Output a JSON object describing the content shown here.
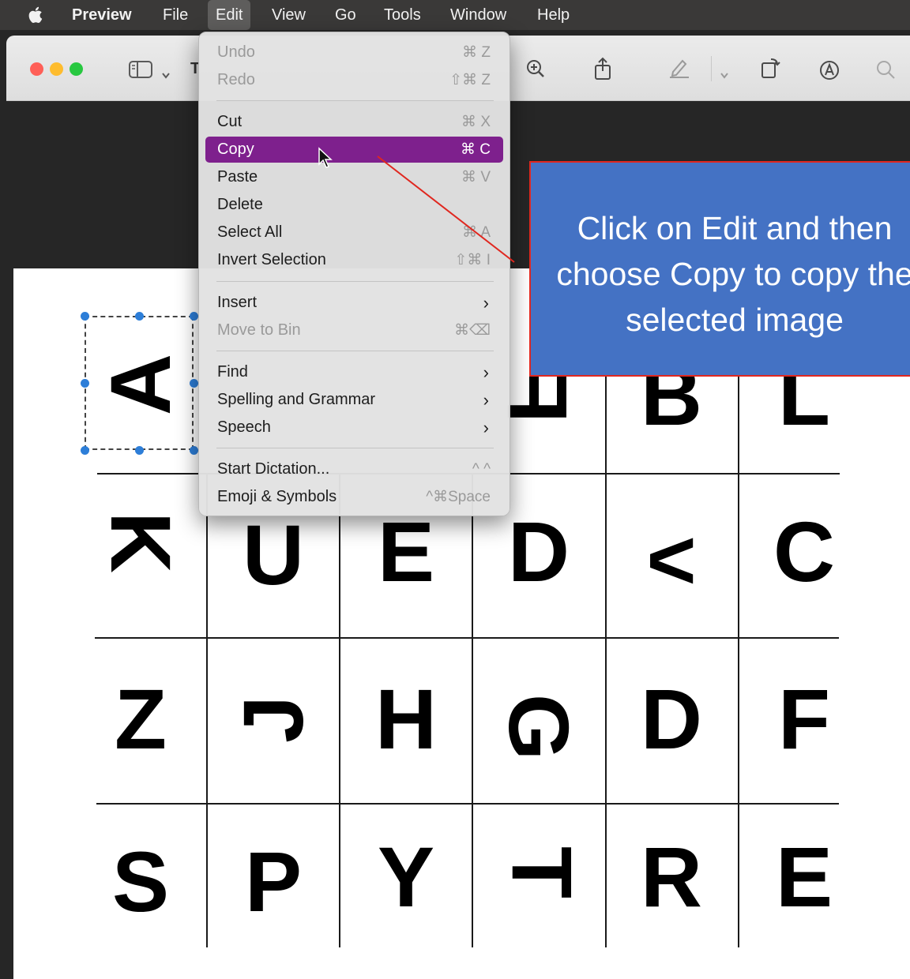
{
  "menubar": {
    "apple_icon": "apple-icon",
    "items": [
      "Preview",
      "File",
      "Edit",
      "View",
      "Go",
      "Tools",
      "Window",
      "Help"
    ],
    "active": "Edit"
  },
  "toolbar": {
    "icons": [
      "sidebar-icon",
      "chevron-down-icon",
      "zoom-in-icon",
      "share-icon",
      "highlight-icon",
      "chevron-down-icon",
      "rotate-icon",
      "markup-icon",
      "search-icon"
    ],
    "title_fragment": "T"
  },
  "edit_menu": {
    "items": [
      {
        "label": "Undo",
        "shortcut": "⌘ Z",
        "enabled": false
      },
      {
        "label": "Redo",
        "shortcut": "⇧⌘ Z",
        "enabled": false
      },
      {
        "label": "Cut",
        "shortcut": "⌘ X",
        "enabled": true
      },
      {
        "label": "Copy",
        "shortcut": "⌘ C",
        "enabled": true,
        "highlighted": true
      },
      {
        "label": "Paste",
        "shortcut": "⌘ V",
        "enabled": true
      },
      {
        "label": "Delete",
        "shortcut": "",
        "enabled": true
      },
      {
        "label": "Select All",
        "shortcut": "⌘ A",
        "enabled": true
      },
      {
        "label": "Invert Selection",
        "shortcut": "⇧⌘ I",
        "enabled": true
      },
      {
        "label": "Insert",
        "submenu": true,
        "enabled": true
      },
      {
        "label": "Move to Bin",
        "shortcut": "⌘⌫",
        "enabled": false
      },
      {
        "label": "Find",
        "submenu": true,
        "enabled": true
      },
      {
        "label": "Spelling and Grammar",
        "submenu": true,
        "enabled": true
      },
      {
        "label": "Speech",
        "submenu": true,
        "enabled": true
      },
      {
        "label": "Start Dictation...",
        "shortcut": "^ ^",
        "enabled": true
      },
      {
        "label": "Emoji & Symbols",
        "shortcut": "^⌘Space",
        "enabled": true
      }
    ],
    "highlight_color": "#7e208d"
  },
  "document": {
    "rows": [
      [
        "A",
        "",
        "",
        "F",
        "B",
        "L"
      ],
      [
        "K",
        "U",
        "E",
        "D",
        "<",
        "C"
      ],
      [
        "Z",
        "J",
        "H",
        "G",
        "D",
        "F"
      ],
      [
        "S",
        "P",
        "Y",
        "T",
        "R",
        "E"
      ]
    ]
  },
  "callout": {
    "text": "Click on Edit and then choose Copy to copy the selected image",
    "background": "#4472c4",
    "border": "#e0271f"
  }
}
